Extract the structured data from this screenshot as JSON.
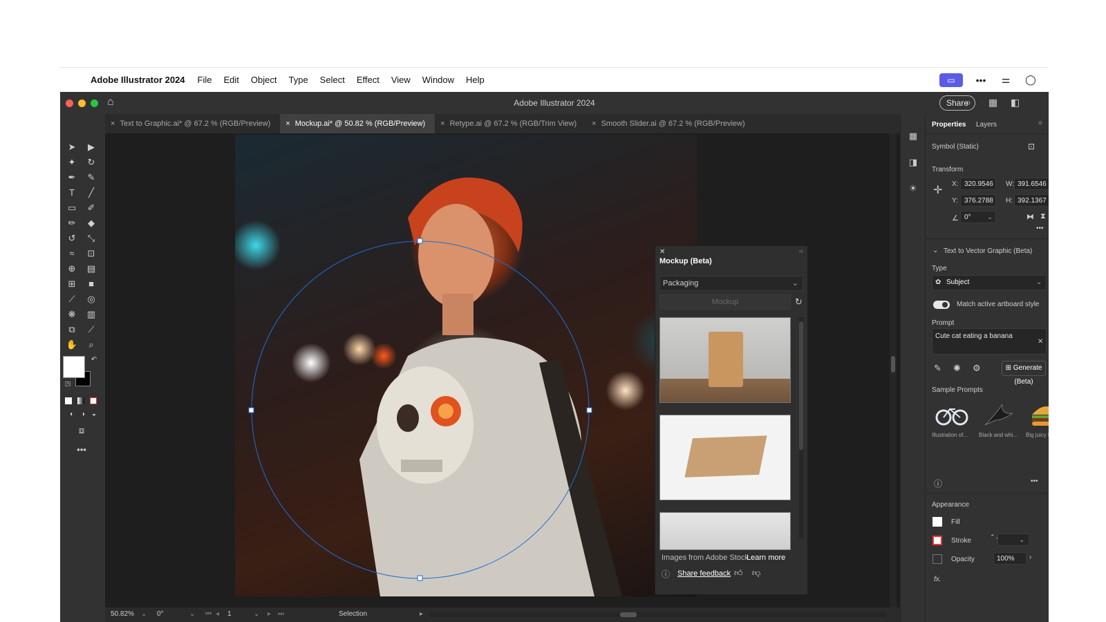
{
  "macos_menubar": {
    "app_name": "Adobe Illustrator 2024",
    "menus": [
      "File",
      "Edit",
      "Object",
      "Type",
      "Select",
      "Effect",
      "View",
      "Window",
      "Help"
    ],
    "icons": [
      "apple-icon",
      "screen-share-icon",
      "more-icon",
      "control-center-icon",
      "siri-icon"
    ]
  },
  "titlebar": {
    "window_title": "Adobe Illustrator 2024",
    "share_label": "Share"
  },
  "tabs": [
    {
      "label": "Text to Graphic.ai* @ 67.2 % (RGB/Preview)",
      "active": false
    },
    {
      "label": "Mockup.ai* @ 50.82 % (RGB/Preview)",
      "active": true
    },
    {
      "label": "Retype.ai @ 67.2 % (RGB/Trim View)",
      "active": false
    },
    {
      "label": "Smooth Slider.ai @ 67.2 % (RGB/Preview)",
      "active": false
    }
  ],
  "mockup_panel": {
    "title": "Mockup (Beta)",
    "category": "Packaging",
    "mockup_button": "Mockup",
    "thumbnails": [
      "paper-pouch",
      "kraft-box",
      "white-product"
    ],
    "source_text": "Images from Adobe Stock",
    "learn_more": "Learn more",
    "feedback": "Share feedback"
  },
  "properties": {
    "tab_properties": "Properties",
    "tab_layers": "Layers",
    "selection_type": "Symbol (Static)",
    "transform": {
      "label": "Transform",
      "x_label": "X:",
      "x": "320.9546",
      "y_label": "Y:",
      "y": "376.2788",
      "w_label": "W:",
      "w": "391.6546",
      "h_label": "H:",
      "h": "392.1367",
      "rotation": "0°"
    },
    "text_to_vector": {
      "section": "Text to Vector Graphic (Beta)",
      "type_label": "Type",
      "type_value": "Subject",
      "match_label": "Match active artboard style",
      "match_on": true,
      "prompt_label": "Prompt",
      "prompt_value": "Cute cat eating a banana",
      "generate_label": "Generate (Beta)",
      "sample_prompts_label": "Sample Prompts",
      "samples": [
        "Illustration of...",
        "Black and whi...",
        "Big juicy burg..."
      ]
    },
    "appearance": {
      "label": "Appearance",
      "fill_label": "Fill",
      "stroke_label": "Stroke",
      "opacity_label": "Opacity",
      "opacity_value": "100%",
      "fx_label": "fx."
    }
  },
  "statusbar": {
    "zoom": "50.82%",
    "rotation": "0°",
    "artboard": "1",
    "tool": "Selection"
  },
  "colors": {
    "accent": "#1473e6",
    "selection": "#1a6fd9",
    "ui_dark": "#323232"
  }
}
